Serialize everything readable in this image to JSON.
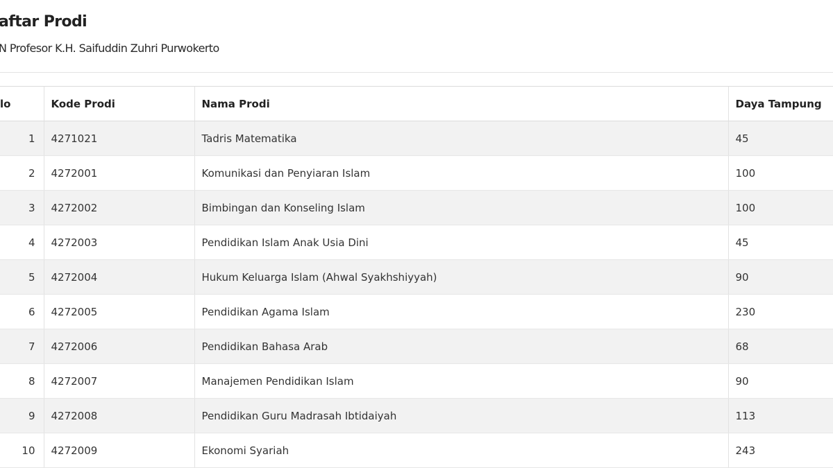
{
  "page": {
    "title": "aftar Prodi",
    "subtitle": "N Profesor K.H. Saifuddin Zuhri Purwokerto"
  },
  "table": {
    "headers": {
      "no": "lo",
      "kode_prodi": "Kode Prodi",
      "nama_prodi": "Nama Prodi",
      "daya_tampung": "Daya Tampung"
    },
    "rows": [
      {
        "no": "1",
        "kode_prodi": "4271021",
        "nama_prodi": "Tadris Matematika",
        "daya_tampung": "45"
      },
      {
        "no": "2",
        "kode_prodi": "4272001",
        "nama_prodi": "Komunikasi dan Penyiaran Islam",
        "daya_tampung": "100"
      },
      {
        "no": "3",
        "kode_prodi": "4272002",
        "nama_prodi": "Bimbingan dan Konseling Islam",
        "daya_tampung": "100"
      },
      {
        "no": "4",
        "kode_prodi": "4272003",
        "nama_prodi": "Pendidikan Islam Anak Usia Dini",
        "daya_tampung": "45"
      },
      {
        "no": "5",
        "kode_prodi": "4272004",
        "nama_prodi": "Hukum Keluarga Islam (Ahwal Syakhshiyyah)",
        "daya_tampung": "90"
      },
      {
        "no": "6",
        "kode_prodi": "4272005",
        "nama_prodi": "Pendidikan Agama Islam",
        "daya_tampung": "230"
      },
      {
        "no": "7",
        "kode_prodi": "4272006",
        "nama_prodi": "Pendidikan Bahasa Arab",
        "daya_tampung": "68"
      },
      {
        "no": "8",
        "kode_prodi": "4272007",
        "nama_prodi": "Manajemen Pendidikan Islam",
        "daya_tampung": "90"
      },
      {
        "no": "9",
        "kode_prodi": "4272008",
        "nama_prodi": "Pendidikan Guru Madrasah Ibtidaiyah",
        "daya_tampung": "113"
      },
      {
        "no": "10",
        "kode_prodi": "4272009",
        "nama_prodi": "Ekonomi Syariah",
        "daya_tampung": "243"
      }
    ]
  }
}
